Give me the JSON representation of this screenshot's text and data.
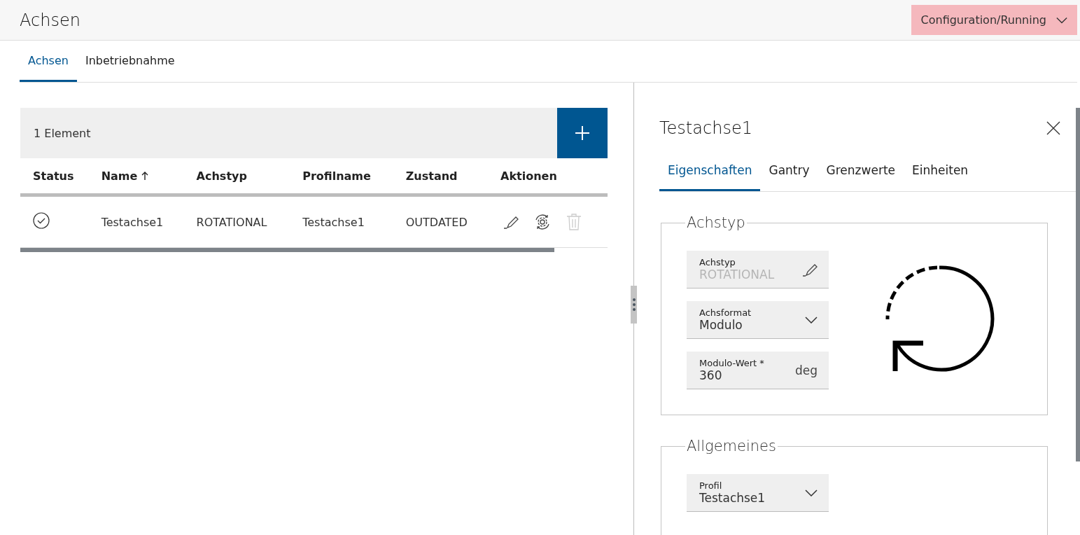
{
  "header": {
    "title": "Achsen",
    "mode_button": "Configuration/Running"
  },
  "tabs": [
    {
      "label": "Achsen",
      "selected": true
    },
    {
      "label": "Inbetriebnahme",
      "selected": false
    }
  ],
  "list": {
    "count": "1 Element",
    "columns": [
      {
        "label": "Status"
      },
      {
        "label": "Name",
        "sorted": true
      },
      {
        "label": "Achstyp"
      },
      {
        "label": "Profilname"
      },
      {
        "label": "Zustand"
      },
      {
        "label": "Aktionen"
      }
    ],
    "rows": [
      {
        "name": "Testachse1",
        "achstyp": "ROTATIONAL",
        "profilname": "Testachse1",
        "zustand": "OUTDATED",
        "delete_disabled": true
      }
    ]
  },
  "detail": {
    "title": "Testachse1",
    "tabs": [
      {
        "label": "Eigenschaften",
        "selected": true
      },
      {
        "label": "Gantry",
        "selected": false
      },
      {
        "label": "Grenzwerte",
        "selected": false
      },
      {
        "label": "Einheiten",
        "selected": false
      }
    ],
    "sections": [
      {
        "legend": "Achstyp",
        "illustration": true,
        "fields": [
          {
            "kind": "readonly",
            "label": "Achstyp",
            "value": "ROTATIONAL"
          },
          {
            "kind": "select",
            "label": "Achsformat",
            "value": "Modulo"
          },
          {
            "kind": "unit",
            "label": "Modulo-Wert *",
            "value": "360",
            "unit": "deg"
          }
        ]
      },
      {
        "legend": "Allgemeines",
        "illustration": false,
        "fields": [
          {
            "kind": "select",
            "label": "Profil",
            "value": "Testachse1"
          }
        ]
      }
    ]
  }
}
